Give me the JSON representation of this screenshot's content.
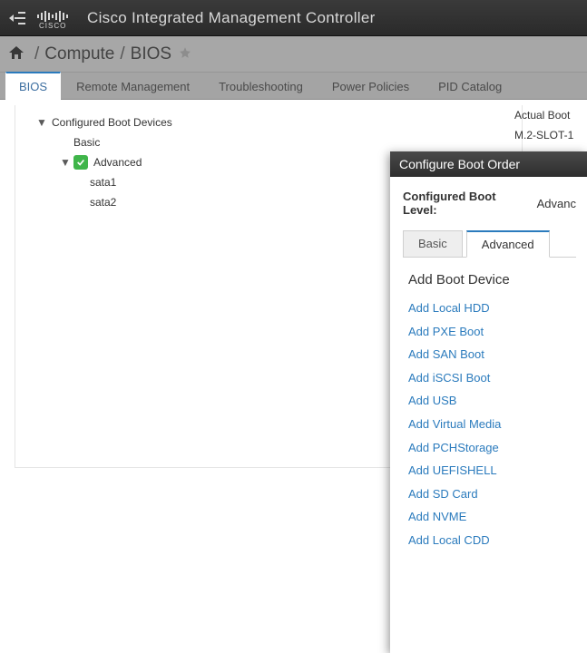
{
  "header": {
    "product_name": "Cisco Integrated Management Controller"
  },
  "breadcrumb": {
    "parent": "Compute",
    "current": "BIOS"
  },
  "tabs": [
    {
      "label": "BIOS",
      "active": true
    },
    {
      "label": "Remote Management",
      "active": false
    },
    {
      "label": "Troubleshooting",
      "active": false
    },
    {
      "label": "Power Policies",
      "active": false
    },
    {
      "label": "PID Catalog",
      "active": false
    }
  ],
  "tree": {
    "root_label": "Configured Boot Devices",
    "basic_label": "Basic",
    "advanced_label": "Advanced",
    "advanced_children": [
      "sata1",
      "sata2"
    ]
  },
  "side": {
    "heading": "Actual Boot",
    "item": "M.2-SLOT-1"
  },
  "modal": {
    "title": "Configure Boot Order",
    "cbl_label": "Configured Boot Level:",
    "cbl_value": "Advanc",
    "tabs": [
      {
        "label": "Basic",
        "active": false
      },
      {
        "label": "Advanced",
        "active": true
      }
    ],
    "add_heading": "Add Boot Device",
    "add_items": [
      {
        "label": "Add Local HDD",
        "highlight": false
      },
      {
        "label": "Add PXE Boot",
        "highlight": false
      },
      {
        "label": "Add SAN Boot",
        "highlight": false
      },
      {
        "label": "Add iSCSI Boot",
        "highlight": false
      },
      {
        "label": "Add USB",
        "highlight": false
      },
      {
        "label": "Add Virtual Media",
        "highlight": false
      },
      {
        "label": "Add PCHStorage",
        "highlight": false
      },
      {
        "label": "Add UEFISHELL",
        "highlight": false
      },
      {
        "label": "Add SD Card",
        "highlight": true
      },
      {
        "label": "Add NVME",
        "highlight": false
      },
      {
        "label": "Add Local CDD",
        "highlight": false
      }
    ]
  }
}
